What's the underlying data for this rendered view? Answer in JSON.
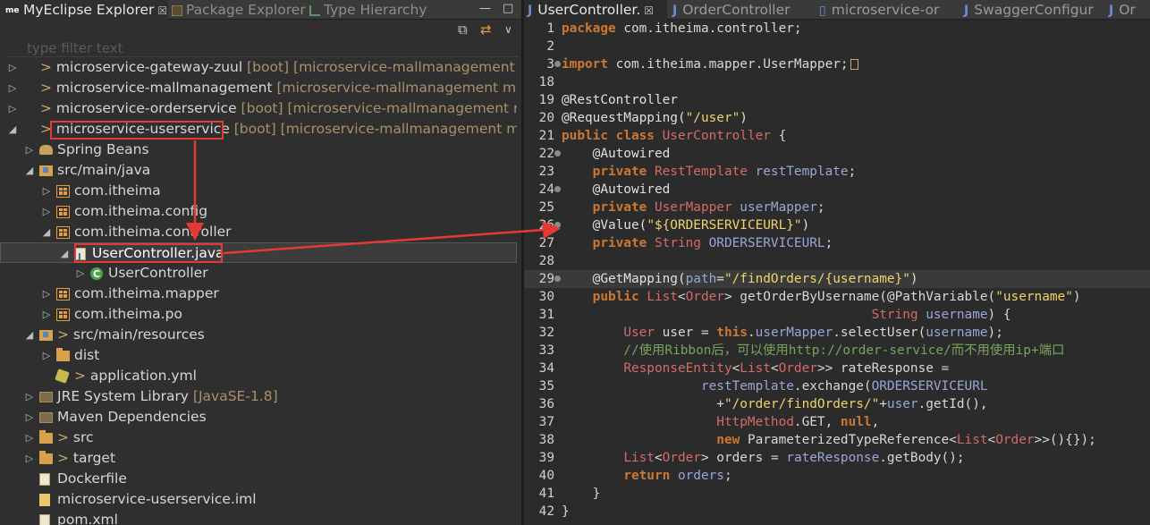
{
  "explorer": {
    "tabs": [
      {
        "label": "MyEclipse Explorer",
        "close": "☒",
        "icon": "me"
      },
      {
        "label": "Package Explorer",
        "icon": "package-explorer-icon"
      },
      {
        "label": "Type Hierarchy",
        "icon": "type-hierarchy-icon"
      }
    ],
    "window_controls": {
      "minimize": "—",
      "maximize": "□"
    },
    "filter_placeholder": "type filter text",
    "tree": [
      {
        "twisty": "▷",
        "icon": "project",
        "prefix": "> ",
        "label": "microservice-gateway-zuul",
        "deco": " [boot] [microservice-mallmanagement master]"
      },
      {
        "twisty": "▷",
        "icon": "project",
        "prefix": "> ",
        "label": "microservice-mallmanagement",
        "deco": " [microservice-mallmanagement master]"
      },
      {
        "twisty": "▷",
        "icon": "project",
        "prefix": "> ",
        "label": "microservice-orderservice",
        "deco": " [boot] [microservice-mallmanagement master]"
      },
      {
        "twisty": "◢",
        "icon": "project",
        "prefix": "> ",
        "label": "microservice-userservice",
        "deco": " [boot] [microservice-mallmanagement master]"
      },
      {
        "twisty": "▷",
        "icon": "bean",
        "prefix": "",
        "label": "Spring Beans",
        "deco": ""
      },
      {
        "twisty": "◢",
        "icon": "srcfolder",
        "prefix": "",
        "label": "src/main/java",
        "deco": ""
      },
      {
        "twisty": "▷",
        "icon": "pkg",
        "prefix": "",
        "label": "com.itheima",
        "deco": ""
      },
      {
        "twisty": "▷",
        "icon": "pkg",
        "prefix": "",
        "label": "com.itheima.config",
        "deco": ""
      },
      {
        "twisty": "◢",
        "icon": "pkg",
        "prefix": "",
        "label": "com.itheima.controller",
        "deco": ""
      },
      {
        "twisty": "◢",
        "icon": "java",
        "prefix": "",
        "label": "UserController.java",
        "deco": ""
      },
      {
        "twisty": "▷",
        "icon": "class",
        "prefix": "",
        "label": "UserController",
        "deco": ""
      },
      {
        "twisty": "▷",
        "icon": "pkg",
        "prefix": "",
        "label": "com.itheima.mapper",
        "deco": ""
      },
      {
        "twisty": "▷",
        "icon": "pkg",
        "prefix": "",
        "label": "com.itheima.po",
        "deco": ""
      },
      {
        "twisty": "◢",
        "icon": "srcfolder",
        "prefix": "> ",
        "label": "src/main/resources",
        "deco": ""
      },
      {
        "twisty": "▷",
        "icon": "folder",
        "prefix": "",
        "label": "dist",
        "deco": ""
      },
      {
        "twisty": "",
        "icon": "yml",
        "prefix": "> ",
        "label": "application.yml",
        "deco": ""
      },
      {
        "twisty": "▷",
        "icon": "lib",
        "prefix": "",
        "label": "JRE System Library",
        "deco": " [JavaSE-1.8]"
      },
      {
        "twisty": "▷",
        "icon": "lib",
        "prefix": "",
        "label": "Maven Dependencies",
        "deco": ""
      },
      {
        "twisty": "▷",
        "icon": "folder",
        "prefix": "> ",
        "label": "src",
        "deco": ""
      },
      {
        "twisty": "▷",
        "icon": "folder",
        "prefix": "> ",
        "label": "target",
        "deco": ""
      },
      {
        "twisty": "",
        "icon": "file",
        "prefix": "",
        "label": "Dockerfile",
        "deco": ""
      },
      {
        "twisty": "",
        "icon": "iml",
        "prefix": "",
        "label": "microservice-userservice.iml",
        "deco": ""
      },
      {
        "twisty": "",
        "icon": "file",
        "prefix": "",
        "label": "pom.xml",
        "deco": ""
      }
    ]
  },
  "editor": {
    "tabs": [
      {
        "label": "UserController.",
        "close": "☒"
      },
      {
        "label": "OrderController"
      },
      {
        "label": "microservice-or"
      },
      {
        "label": "SwaggerConfigur"
      },
      {
        "label": "Or"
      }
    ],
    "lines": [
      {
        "n": "1",
        "fold": false,
        "hl": false,
        "t": [
          [
            "kw",
            "package "
          ],
          [
            "id",
            "com.itheima.controller;"
          ]
        ]
      },
      {
        "n": "2",
        "fold": false,
        "hl": false,
        "t": []
      },
      {
        "n": "3",
        "fold": true,
        "hl": false,
        "t": [
          [
            "kw",
            "import "
          ],
          [
            "id",
            "com.itheima.mapper.UserMapper;"
          ]
        ],
        "box": true
      },
      {
        "n": "18",
        "fold": false,
        "hl": false,
        "t": []
      },
      {
        "n": "19",
        "fold": false,
        "hl": false,
        "t": [
          [
            "ann",
            "@RestController"
          ]
        ]
      },
      {
        "n": "20",
        "fold": false,
        "hl": false,
        "t": [
          [
            "ann",
            "@RequestMapping("
          ],
          [
            "str",
            "\"/user\""
          ],
          [
            "ann",
            ")"
          ]
        ]
      },
      {
        "n": "21",
        "fold": false,
        "hl": false,
        "t": [
          [
            "kw",
            "public class "
          ],
          [
            "ty",
            "UserController"
          ],
          [
            "id",
            " {"
          ]
        ]
      },
      {
        "n": "22",
        "fold": true,
        "hl": false,
        "t": [
          [
            "id",
            "    "
          ],
          [
            "ann",
            "@Autowired"
          ]
        ]
      },
      {
        "n": "23",
        "fold": false,
        "hl": false,
        "t": [
          [
            "id",
            "    "
          ],
          [
            "kw",
            "private "
          ],
          [
            "ty",
            "RestTemplate "
          ],
          [
            "fld",
            "restTemplate"
          ],
          [
            "id",
            ";"
          ]
        ]
      },
      {
        "n": "24",
        "fold": true,
        "hl": false,
        "t": [
          [
            "id",
            "    "
          ],
          [
            "ann",
            "@Autowired"
          ]
        ]
      },
      {
        "n": "25",
        "fold": false,
        "hl": false,
        "t": [
          [
            "id",
            "    "
          ],
          [
            "kw",
            "private "
          ],
          [
            "ty",
            "UserMapper "
          ],
          [
            "fld",
            "userMapper"
          ],
          [
            "id",
            ";"
          ]
        ]
      },
      {
        "n": "26",
        "fold": true,
        "hl": false,
        "t": [
          [
            "id",
            "    "
          ],
          [
            "ann",
            "@Value("
          ],
          [
            "str",
            "\"${ORDERSERVICEURL}\""
          ],
          [
            "ann",
            ")"
          ]
        ]
      },
      {
        "n": "27",
        "fold": false,
        "hl": false,
        "t": [
          [
            "id",
            "    "
          ],
          [
            "kw",
            "private "
          ],
          [
            "ty",
            "String "
          ],
          [
            "fld",
            "ORDERSERVICEURL"
          ],
          [
            "id",
            ";"
          ]
        ]
      },
      {
        "n": "28",
        "fold": false,
        "hl": false,
        "t": []
      },
      {
        "n": "29",
        "fold": true,
        "hl": true,
        "t": [
          [
            "id",
            "    "
          ],
          [
            "ann",
            "@GetMapping("
          ],
          [
            "pvar",
            "path"
          ],
          [
            "ann",
            "="
          ],
          [
            "str",
            "\"/findOrders/{username}\""
          ],
          [
            "ann",
            ")"
          ]
        ]
      },
      {
        "n": "30",
        "fold": false,
        "hl": false,
        "t": [
          [
            "id",
            "    "
          ],
          [
            "kw",
            "public "
          ],
          [
            "ty",
            "List"
          ],
          [
            "id",
            "<"
          ],
          [
            "ty",
            "Order"
          ],
          [
            "id",
            "> getOrderByUsername(@PathVariable("
          ],
          [
            "str",
            "\"username\""
          ],
          [
            "id",
            ")"
          ]
        ]
      },
      {
        "n": "31",
        "fold": false,
        "hl": false,
        "t": [
          [
            "id",
            "                                        "
          ],
          [
            "ty",
            "String "
          ],
          [
            "param",
            "username"
          ],
          [
            "id",
            ") {"
          ]
        ]
      },
      {
        "n": "32",
        "fold": false,
        "hl": false,
        "t": [
          [
            "id",
            "        "
          ],
          [
            "ty",
            "User "
          ],
          [
            "id",
            "user = "
          ],
          [
            "kw",
            "this"
          ],
          [
            "id",
            "."
          ],
          [
            "fld",
            "userMapper"
          ],
          [
            "id",
            ".selectUser("
          ],
          [
            "param",
            "username"
          ],
          [
            "id",
            ");"
          ]
        ]
      },
      {
        "n": "33",
        "fold": false,
        "hl": false,
        "t": [
          [
            "cmt",
            "        //使用Ribbon后，可以使用http://order-service/而不用使用ip+端口"
          ]
        ]
      },
      {
        "n": "34",
        "fold": false,
        "hl": false,
        "t": [
          [
            "id",
            "        "
          ],
          [
            "ty",
            "ResponseEntity"
          ],
          [
            "id",
            "<"
          ],
          [
            "ty",
            "List"
          ],
          [
            "id",
            "<"
          ],
          [
            "ty",
            "Order"
          ],
          [
            "id",
            ">> rateResponse ="
          ]
        ]
      },
      {
        "n": "35",
        "fold": false,
        "hl": false,
        "t": [
          [
            "id",
            "                  "
          ],
          [
            "fld",
            "restTemplate"
          ],
          [
            "id",
            ".exchange("
          ],
          [
            "fld",
            "ORDERSERVICEURL"
          ]
        ]
      },
      {
        "n": "36",
        "fold": false,
        "hl": false,
        "t": [
          [
            "id",
            "                    +"
          ],
          [
            "str",
            "\"/order/findOrders/\""
          ],
          [
            "id",
            "+"
          ],
          [
            "fld",
            "user"
          ],
          [
            "id",
            ".getId(),"
          ]
        ]
      },
      {
        "n": "37",
        "fold": false,
        "hl": false,
        "t": [
          [
            "id",
            "                    "
          ],
          [
            "ty",
            "HttpMethod"
          ],
          [
            "id",
            ".GET, "
          ],
          [
            "kw",
            "null"
          ],
          [
            "id",
            ","
          ]
        ]
      },
      {
        "n": "38",
        "fold": false,
        "hl": false,
        "t": [
          [
            "id",
            "                    "
          ],
          [
            "kw",
            "new "
          ],
          [
            "id",
            "ParameterizedTypeReference<"
          ],
          [
            "ty",
            "List"
          ],
          [
            "id",
            "<"
          ],
          [
            "ty",
            "Order"
          ],
          [
            "id",
            ">>(){});"
          ]
        ]
      },
      {
        "n": "39",
        "fold": false,
        "hl": false,
        "t": [
          [
            "id",
            "        "
          ],
          [
            "ty",
            "List"
          ],
          [
            "id",
            "<"
          ],
          [
            "ty",
            "Order"
          ],
          [
            "id",
            "> orders = "
          ],
          [
            "fld",
            "rateResponse"
          ],
          [
            "id",
            ".getBody();"
          ]
        ]
      },
      {
        "n": "40",
        "fold": false,
        "hl": false,
        "t": [
          [
            "id",
            "        "
          ],
          [
            "kw",
            "return "
          ],
          [
            "fld",
            "orders"
          ],
          [
            "id",
            ";"
          ]
        ]
      },
      {
        "n": "41",
        "fold": false,
        "hl": false,
        "t": [
          [
            "id",
            "    }"
          ]
        ]
      },
      {
        "n": "42",
        "fold": false,
        "hl": false,
        "t": [
          [
            "id",
            "}"
          ]
        ]
      }
    ]
  },
  "colors": {
    "annotation_red": "#e53935",
    "keyword": "#cc7832",
    "string": "#f0d36b",
    "comment": "#78a361"
  }
}
